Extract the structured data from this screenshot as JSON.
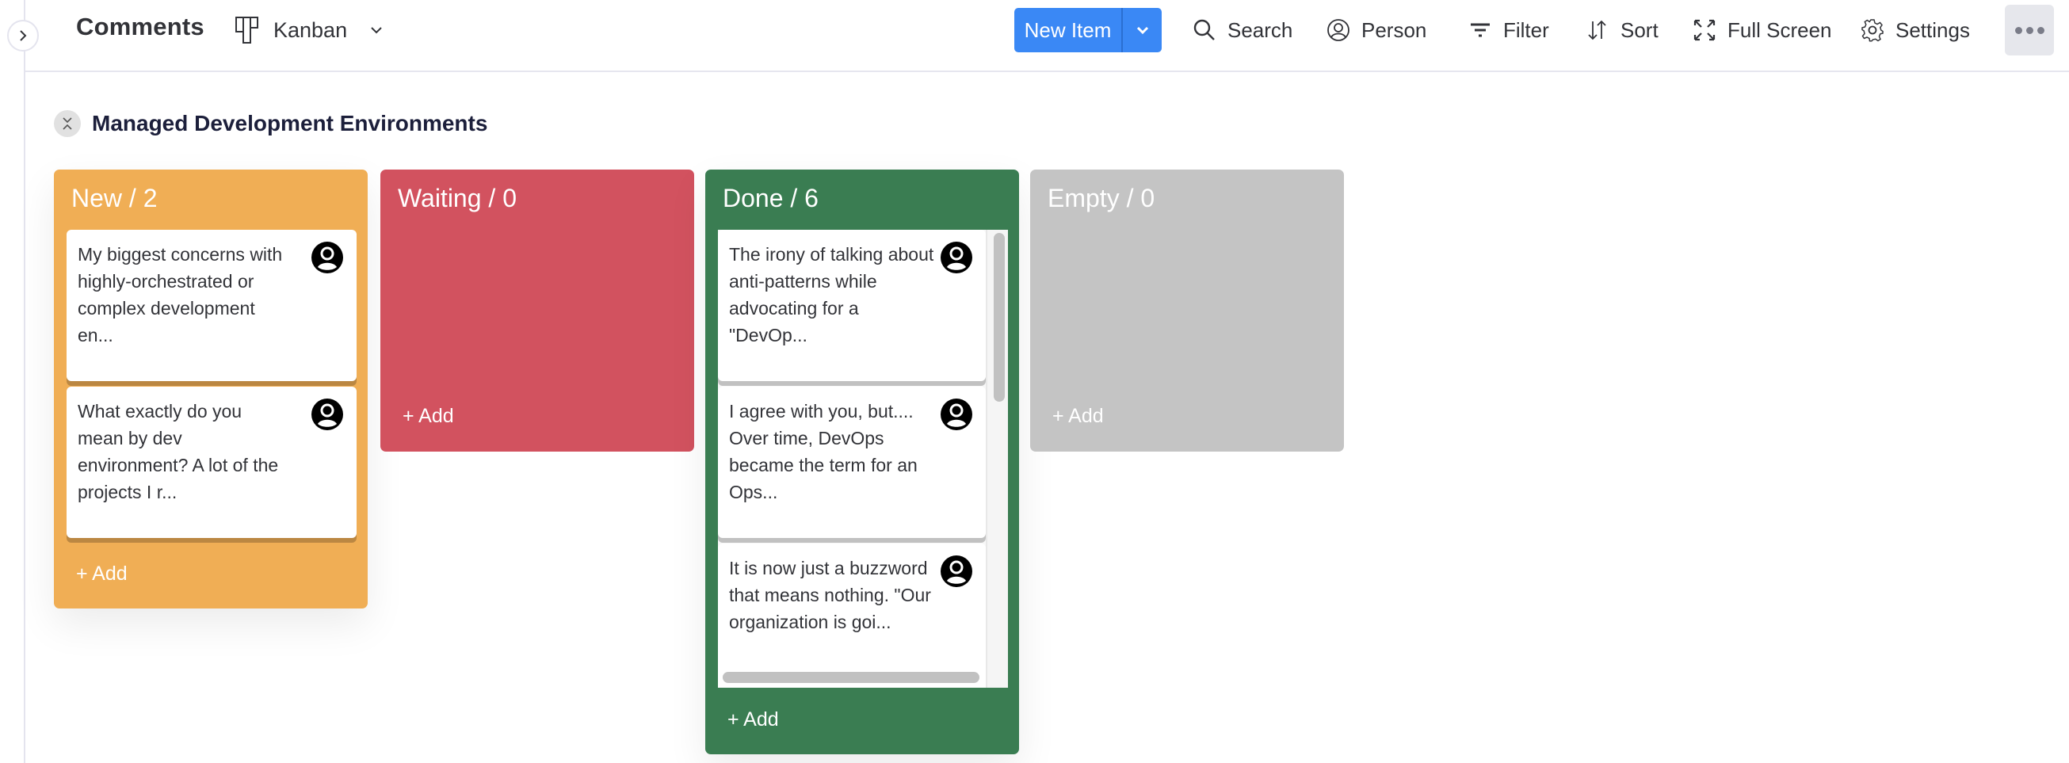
{
  "header": {
    "title": "Comments",
    "view": {
      "label": "Kanban",
      "icon": "kanban-icon"
    },
    "new_item": {
      "label": "New Item"
    },
    "tools": [
      {
        "id": "search",
        "label": "Search",
        "icon": "search-icon"
      },
      {
        "id": "person",
        "label": "Person",
        "icon": "person-icon"
      },
      {
        "id": "filter",
        "label": "Filter",
        "icon": "filter-icon"
      },
      {
        "id": "sort",
        "label": "Sort",
        "icon": "sort-icon"
      },
      {
        "id": "fullscreen",
        "label": "Full Screen",
        "icon": "fullscreen-icon"
      },
      {
        "id": "settings",
        "label": "Settings",
        "icon": "gear-icon"
      }
    ]
  },
  "group": {
    "title": "Managed Development Environments"
  },
  "columns": [
    {
      "title": "New / 2",
      "color": "#f0ae55",
      "add_label": "+ Add",
      "cards": [
        {
          "text": "My biggest concerns with highly-orchestrated or complex development en..."
        },
        {
          "text": "What exactly do you mean by dev environment? A lot of the projects I r..."
        }
      ]
    },
    {
      "title": "Waiting / 0",
      "color": "#d2525f",
      "add_label": "+ Add",
      "cards": []
    },
    {
      "title": "Done / 6",
      "color": "#3a7d52",
      "add_label": "+ Add",
      "cards": [
        {
          "text": "The irony of talking about anti-patterns while advocating for a \"DevOp..."
        },
        {
          "text": "I agree with you, but.... Over time, DevOps became the term for an Ops..."
        },
        {
          "text": "It is now just a buzzword that means nothing. \"Our organization is goi..."
        }
      ]
    },
    {
      "title": "Empty / 0",
      "color": "#c4c4c4",
      "add_label": "+ Add",
      "cards": []
    }
  ],
  "colors": {
    "primary": "#3a88f5",
    "text": "#323338"
  }
}
